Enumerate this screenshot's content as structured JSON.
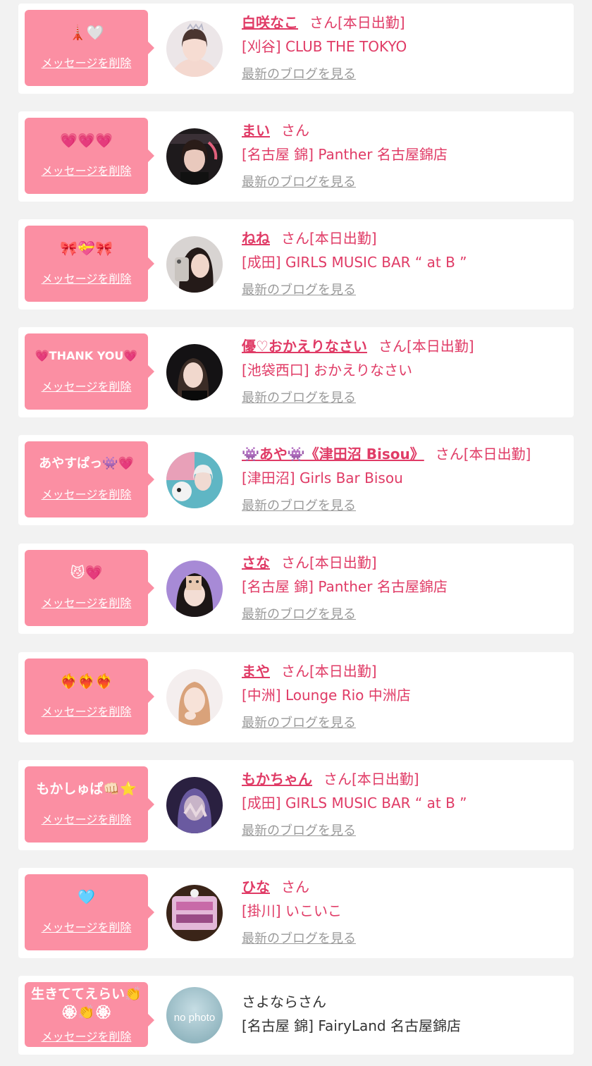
{
  "colors": {
    "accent": "#e03b66",
    "bubble": "#fb8fa3",
    "link_gray": "#9a9a9a"
  },
  "labels": {
    "delete": "メッセージを削除",
    "blog": "最新のブログを見る",
    "san": "さん"
  },
  "items": [
    {
      "message": "🗼🤍",
      "name": "白咲なこ",
      "status": "[本日出勤]",
      "shop": "[刈谷] CLUB THE TOKYO"
    },
    {
      "message": "💗💗💗",
      "name": "まい",
      "status": "",
      "shop": "[名古屋 錦] Panther 名古屋錦店"
    },
    {
      "message": "🎀💝🎀",
      "name": "ねね",
      "status": "[本日出勤]",
      "shop": "[成田] GIRLS MUSIC BAR “ at B ”"
    },
    {
      "message": "💗THANK YOU💗",
      "name": "優♡おかえりなさい",
      "status": "[本日出勤]",
      "shop": "[池袋西口] おかえりなさい"
    },
    {
      "message": "あやすぱっ👾💗",
      "name": "👾あや👾《津田沼 Bisou》",
      "status": "[本日出勤]",
      "shop": "[津田沼] Girls Bar Bisou"
    },
    {
      "message": "😼💗",
      "name": "さな",
      "status": "[本日出勤]",
      "shop": "[名古屋 錦] Panther 名古屋錦店"
    },
    {
      "message": "❤️‍🔥❤️‍🔥❤️‍🔥",
      "name": "まや",
      "status": "[本日出勤]",
      "shop": "[中洲] Lounge Rio 中洲店"
    },
    {
      "message": "もかしゅぱ👊🏻⭐",
      "name": "もかちゃん",
      "status": "[本日出勤]",
      "shop": "[成田] GIRLS MUSIC BAR “ at B ”"
    },
    {
      "message": "🩵",
      "name": "ひな",
      "status": "",
      "shop": "[掛川] いこいこ"
    },
    {
      "message": "生きててえらい👏🏵👏🏵",
      "name": "さよなら",
      "status": "",
      "shop": "[名古屋 錦] FairyLand 名古屋錦店",
      "avatar_text": "no photo"
    }
  ]
}
